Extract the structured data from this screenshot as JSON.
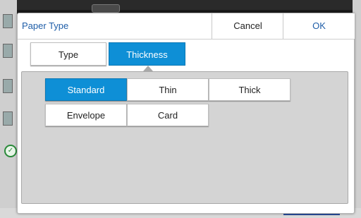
{
  "dialog": {
    "title": "Paper Type",
    "cancel_label": "Cancel",
    "ok_label": "OK"
  },
  "segments": {
    "type_label": "Type",
    "thickness_label": "Thickness",
    "selected": "Thickness"
  },
  "options": [
    {
      "label": "Standard",
      "selected": true
    },
    {
      "label": "Thin",
      "selected": false
    },
    {
      "label": "Thick",
      "selected": false
    },
    {
      "label": "Envelope",
      "selected": false
    },
    {
      "label": "Card",
      "selected": false
    }
  ],
  "colors": {
    "accent": "#0e8fd6",
    "title_text": "#1f5ea8",
    "panel_bg": "#d4d4d4"
  }
}
